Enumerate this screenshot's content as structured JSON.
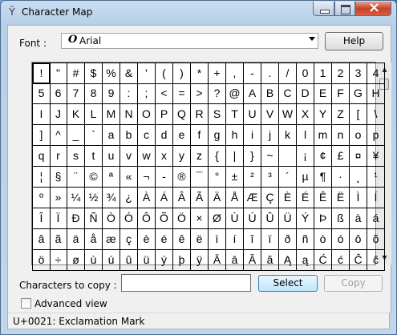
{
  "window": {
    "title": "Character Map",
    "app_icon": "character-map-icon"
  },
  "font": {
    "label": "Font :",
    "value": "Arial",
    "icon": "opentype-font-icon"
  },
  "buttons": {
    "help": "Help",
    "select": "Select",
    "copy": "Copy"
  },
  "copy": {
    "label": "Characters to copy :",
    "value": ""
  },
  "advanced_view": {
    "label": "Advanced view",
    "checked": false
  },
  "status": {
    "text": "U+0021: Exclamation Mark"
  },
  "grid": {
    "selected_index": 0,
    "rows": [
      [
        "!",
        "\"",
        "#",
        "$",
        "%",
        "&",
        "'",
        "(",
        ")",
        "*",
        "+",
        ",",
        "-",
        ".",
        "/",
        "0",
        "1",
        "2",
        "3",
        "4"
      ],
      [
        "5",
        "6",
        "7",
        "8",
        "9",
        ":",
        ";",
        "<",
        "=",
        ">",
        "?",
        "@",
        "A",
        "B",
        "C",
        "D",
        "E",
        "F",
        "G",
        "H"
      ],
      [
        "I",
        "J",
        "K",
        "L",
        "M",
        "N",
        "O",
        "P",
        "Q",
        "R",
        "S",
        "T",
        "U",
        "V",
        "W",
        "X",
        "Y",
        "Z",
        "[",
        "\\"
      ],
      [
        "]",
        "^",
        "_",
        "`",
        "a",
        "b",
        "c",
        "d",
        "e",
        "f",
        "g",
        "h",
        "i",
        "j",
        "k",
        "l",
        "m",
        "n",
        "o",
        "p"
      ],
      [
        "q",
        "r",
        "s",
        "t",
        "u",
        "v",
        "w",
        "x",
        "y",
        "z",
        "{",
        "|",
        "}",
        "~",
        " ",
        "¡",
        "¢",
        "£",
        "¤",
        "¥"
      ],
      [
        "¦",
        "§",
        "¨",
        "©",
        "ª",
        "«",
        "¬",
        "-",
        "®",
        "¯",
        "°",
        "±",
        "²",
        "³",
        "´",
        "µ",
        "¶",
        "·",
        "¸",
        "¹"
      ],
      [
        "º",
        "»",
        "¼",
        "½",
        "¾",
        "¿",
        "À",
        "Á",
        "Â",
        "Ã",
        "Ä",
        "Å",
        "Æ",
        "Ç",
        "È",
        "É",
        "Ê",
        "Ë",
        "Ì",
        "Í"
      ],
      [
        "Î",
        "Ï",
        "Ð",
        "Ñ",
        "Ò",
        "Ó",
        "Ô",
        "Õ",
        "Ö",
        "×",
        "Ø",
        "Ù",
        "Ú",
        "Û",
        "Ü",
        "Ý",
        "Þ",
        "ß",
        "à",
        "á"
      ],
      [
        "â",
        "ã",
        "ä",
        "å",
        "æ",
        "ç",
        "è",
        "é",
        "ê",
        "ë",
        "ì",
        "í",
        "î",
        "ï",
        "ð",
        "ñ",
        "ò",
        "ó",
        "ô",
        "õ"
      ],
      [
        "ö",
        "÷",
        "ø",
        "ù",
        "ú",
        "û",
        "ü",
        "ý",
        "þ",
        "ÿ",
        "Ā",
        "ā",
        "Ă",
        "ă",
        "Ą",
        "ą",
        "Ć",
        "ć",
        "Ĉ",
        "ĉ"
      ]
    ]
  },
  "scrollbar": {
    "up_icon": "scroll-up-arrow-icon",
    "down_icon": "scroll-down-arrow-icon"
  }
}
